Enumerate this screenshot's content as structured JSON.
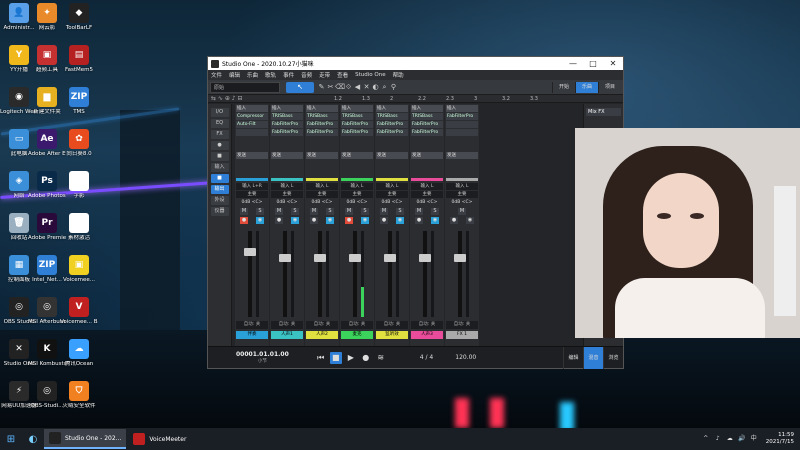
{
  "desktop": {
    "icons": [
      {
        "label": "Administr...",
        "color": "#5aa0e8",
        "glyph": "👤"
      },
      {
        "label": "网云影",
        "color": "#e88a2a",
        "glyph": "✦"
      },
      {
        "label": "ToolBarLF",
        "color": "#222222",
        "glyph": "◆"
      },
      {
        "label": "YY开播",
        "color": "#f0b81a",
        "glyph": "Y"
      },
      {
        "label": "超频工具",
        "color": "#c53030",
        "glyph": "▣"
      },
      {
        "label": "FastMem5",
        "color": "#b52020",
        "glyph": "▤"
      },
      {
        "label": "Logitech Webcam...",
        "color": "#2a2a2a",
        "glyph": "◉"
      },
      {
        "label": "新建文件夹",
        "color": "#e6b020",
        "glyph": "▆"
      },
      {
        "label": "TMS",
        "color": "#2f7fd6",
        "glyph": "ZIP"
      },
      {
        "label": "此电脑",
        "color": "#3a8fd8",
        "glyph": "▭"
      },
      {
        "label": "Adobe After Effects 2020",
        "color": "#3b1a6e",
        "glyph": "Ae"
      },
      {
        "label": "向日葵8.0",
        "color": "#e84c1e",
        "glyph": "✿"
      },
      {
        "label": "网络",
        "color": "#3a8fd8",
        "glyph": "◈"
      },
      {
        "label": "Adobe Photosh...",
        "color": "#0a2a4a",
        "glyph": "Ps"
      },
      {
        "label": "字影",
        "color": "#ffffff",
        "glyph": ""
      },
      {
        "label": "回收站",
        "color": "#9ab0c0",
        "glyph": "🗑"
      },
      {
        "label": "Adobe Premie...",
        "color": "#2a0a3a",
        "glyph": "Pr"
      },
      {
        "label": "素材激活",
        "color": "#ffffff",
        "glyph": ""
      },
      {
        "label": "控制面板",
        "color": "#3a8fd8",
        "glyph": "▦"
      },
      {
        "label": "Intel_Net...",
        "color": "#2f7fd6",
        "glyph": "ZIP"
      },
      {
        "label": "Voicemee...",
        "color": "#f0d020",
        "glyph": "▣"
      },
      {
        "label": "OBS Studio",
        "color": "#222222",
        "glyph": "◎"
      },
      {
        "label": "MSI Afterburner",
        "color": "#333333",
        "glyph": "◎"
      },
      {
        "label": "Voicemee... Banana",
        "color": "#c02020",
        "glyph": "V"
      },
      {
        "label": "Studio One",
        "color": "#222222",
        "glyph": "✕"
      },
      {
        "label": "MSI Kombustor...",
        "color": "#111111",
        "glyph": "K"
      },
      {
        "label": "腾讯Ocean",
        "color": "#3aa0ff",
        "glyph": "☁"
      },
      {
        "label": "网易UU加速器",
        "color": "#2a2a2a",
        "glyph": "⚡"
      },
      {
        "label": "OBS-Studi...",
        "color": "#222222",
        "glyph": "◎"
      },
      {
        "label": "火绒安全软件",
        "color": "#f08020",
        "glyph": "⛉"
      }
    ]
  },
  "studio_one": {
    "title": "Studio One - 2020.10.27小猫咪",
    "window_buttons": [
      "—",
      "□",
      "✕"
    ],
    "menu": [
      "文件",
      "编辑",
      "乐曲",
      "歌轨",
      "事件",
      "音频",
      "走带",
      "查看",
      "Studio One",
      "帮助"
    ],
    "toolbar": {
      "combo_value": "原始",
      "tools": [
        "✎",
        "✂",
        "⌫",
        "⟐",
        "◀",
        "✕",
        "◐",
        "⌕",
        "⚲"
      ],
      "pill_start": "开始",
      "pill_song": "乐曲",
      "pill_project": "项目"
    },
    "ruler_ticks": [
      "1.2",
      "1.3",
      "2",
      "2.2",
      "2.3",
      "3",
      "3.2",
      "3.3"
    ],
    "left_tools": [
      "I/O",
      "EQ",
      "FX",
      "●",
      "■",
      "输入",
      "■",
      "输出",
      "外设",
      "仪器"
    ],
    "strips": [
      {
        "inserts": [
          "插入",
          "Compressor",
          "Auto-Filt"
        ],
        "sends": "发送",
        "route_in": "输入 L+R",
        "route_out": "主要",
        "pan": "0dB  <C>",
        "fader_pos": 0.22,
        "meter": 0.0,
        "mute": "M",
        "solo": "S",
        "rec": true,
        "mon": true,
        "name": "伴奏",
        "color": "#2aa0d8",
        "auto": "自动: 关"
      },
      {
        "inserts": [
          "插入",
          "TRISBass",
          "FabFilterPro",
          "FabFilterPro"
        ],
        "sends": "发送",
        "route_in": "输入 L",
        "route_out": "主要",
        "pan": "0dB  <C>",
        "fader_pos": 0.3,
        "meter": 0.0,
        "mute": "M",
        "solo": "S",
        "rec": false,
        "mon": true,
        "name": "人声1",
        "color": "#3bc2c2",
        "auto": "自动: 关"
      },
      {
        "inserts": [
          "插入",
          "TRISBass",
          "FabFilterPro",
          "FabFilterPro"
        ],
        "sends": "发送",
        "route_in": "输入 L",
        "route_out": "主要",
        "pan": "0dB  <C>",
        "fader_pos": 0.3,
        "meter": 0.0,
        "mute": "M",
        "solo": "S",
        "rec": false,
        "mon": true,
        "name": "人声2",
        "color": "#e0e040",
        "auto": "自动: 关"
      },
      {
        "inserts": [
          "插入",
          "TRISBass",
          "FabFilterPro",
          "FabFilterPro"
        ],
        "sends": "发送",
        "route_in": "输入 L",
        "route_out": "主要",
        "pan": "0dB  <C>",
        "fader_pos": 0.3,
        "meter": 0.35,
        "mute": "M",
        "solo": "S",
        "rec": true,
        "mon": true,
        "name": "麦克",
        "color": "#3bd35b",
        "auto": "自动: 关"
      },
      {
        "inserts": [
          "插入",
          "TRISBass",
          "FabFilterPro",
          "FabFilterPro"
        ],
        "sends": "发送",
        "route_in": "输入 L",
        "route_out": "主要",
        "pan": "0dB  <C>",
        "fader_pos": 0.3,
        "meter": 0.0,
        "mute": "M",
        "solo": "S",
        "rec": false,
        "mon": true,
        "name": "监听效",
        "color": "#e0e040",
        "auto": "自动: 关"
      },
      {
        "inserts": [
          "插入",
          "TRISBass",
          "FabFilterPro",
          "FabFilterPro"
        ],
        "sends": "发送",
        "route_in": "输入 L",
        "route_out": "主要",
        "pan": "0dB  <C>",
        "fader_pos": 0.3,
        "meter": 0.0,
        "mute": "M",
        "solo": "S",
        "rec": false,
        "mon": true,
        "name": "人声3",
        "color": "#e84c9a",
        "auto": "自动: 关"
      },
      {
        "inserts": [
          "插入",
          "FabFilterPro"
        ],
        "sends": "发送",
        "route_in": "输入 L",
        "route_out": "主要",
        "pan": "0dB  <C>",
        "fader_pos": 0.3,
        "meter": 0.0,
        "mute": "M",
        "solo": "",
        "rec": false,
        "mon": false,
        "name": "FX 1",
        "color": "#aaaaaa",
        "auto": "自动: 关"
      }
    ],
    "mix_fx_label": "Mix FX",
    "transport": {
      "time": "00001.01.01.00",
      "sub": "小节",
      "signature": "4 / 4",
      "tempo": "120.00",
      "tabs": [
        "编辑",
        "混音",
        "浏览"
      ]
    }
  },
  "taskbar": {
    "apps": [
      {
        "label": "Studio One - 202...",
        "color": "#222222",
        "active": true
      },
      {
        "label": "VoiceMeeter",
        "color": "#c02020",
        "active": false
      }
    ],
    "tray": [
      "^",
      "♪",
      "☁",
      "🔊",
      "中"
    ],
    "time": "11:59",
    "date": "2021/7/15"
  }
}
